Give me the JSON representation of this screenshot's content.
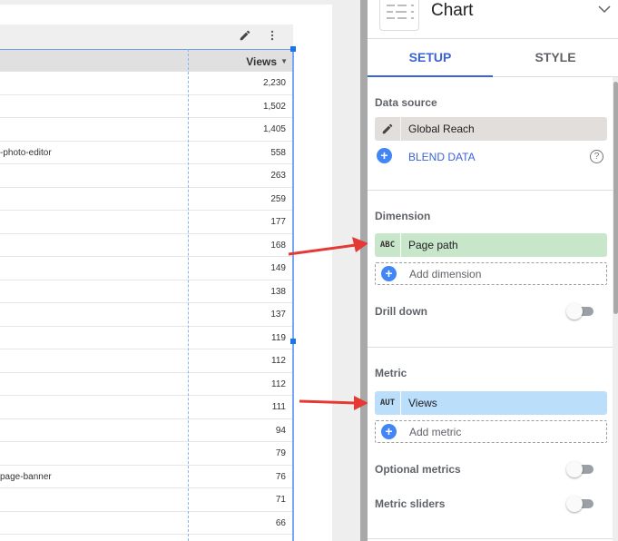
{
  "table": {
    "header": {
      "views_label": "Views",
      "sort_icon": "sort-desc-caret"
    },
    "toolbar": {
      "edit_icon": "pencil-icon",
      "more_icon": "more-vert-icon"
    },
    "rows": [
      {
        "path": "",
        "views": "2,230"
      },
      {
        "path": "",
        "views": "1,502"
      },
      {
        "path": "",
        "views": "1,405"
      },
      {
        "path": "-photo-editor",
        "views": "558"
      },
      {
        "path": "",
        "views": "263"
      },
      {
        "path": "",
        "views": "259"
      },
      {
        "path": "",
        "views": "177"
      },
      {
        "path": "",
        "views": "168"
      },
      {
        "path": "",
        "views": "149"
      },
      {
        "path": "",
        "views": "138"
      },
      {
        "path": "",
        "views": "137"
      },
      {
        "path": "",
        "views": "119"
      },
      {
        "path": "",
        "views": "112"
      },
      {
        "path": "",
        "views": "112"
      },
      {
        "path": "",
        "views": "111"
      },
      {
        "path": "",
        "views": "94"
      },
      {
        "path": "",
        "views": "79"
      },
      {
        "path": "page-banner",
        "views": "76"
      },
      {
        "path": "",
        "views": "71"
      },
      {
        "path": "",
        "views": "66"
      }
    ]
  },
  "annotations": {
    "arrow_color": "#e53935"
  },
  "panel": {
    "title": "Chart",
    "collapse_icon": "chevron-down-icon",
    "tabs": [
      {
        "label": "SETUP",
        "active": true
      },
      {
        "label": "STYLE",
        "active": false
      }
    ],
    "data_source": {
      "label": "Data source",
      "name": "Global Reach",
      "blend_label": "BLEND DATA",
      "help_icon": "help-circle-icon"
    },
    "dimension": {
      "label": "Dimension",
      "chip_type": "ABC",
      "chip_label": "Page path",
      "add_label": "Add dimension",
      "drill_down_label": "Drill down",
      "drill_down_on": false
    },
    "metric": {
      "label": "Metric",
      "chip_type": "AUT",
      "chip_label": "Views",
      "add_label": "Add metric",
      "optional_metrics_label": "Optional metrics",
      "optional_metrics_on": false,
      "metric_sliders_label": "Metric sliders",
      "metric_sliders_on": false
    },
    "colors": {
      "accent": "#3b63d8",
      "data_source_chip": "#e2dedb",
      "dimension_chip": "#c8e6c9",
      "metric_chip": "#bbdefb"
    }
  }
}
